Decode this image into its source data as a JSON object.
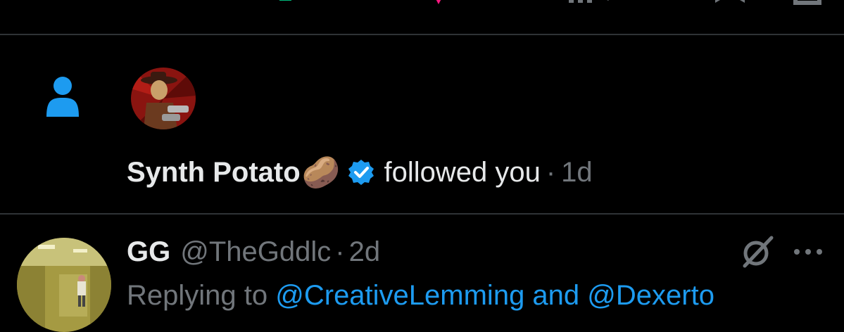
{
  "top_actions": [
    {
      "name": "reply-icon"
    },
    {
      "name": "retweet-icon",
      "color": "#00ba7c"
    },
    {
      "name": "like-icon",
      "color": "#f91880"
    },
    {
      "name": "views-icon"
    },
    {
      "name": "bookmark-icon"
    },
    {
      "name": "share-icon"
    }
  ],
  "notification": {
    "icon": "person-icon",
    "icon_color": "#1d9bf0",
    "user_name": "Synth Potato",
    "emoji": "🥔",
    "verified_icon": "verified-badge-icon",
    "action_text": "followed you",
    "separator": "·",
    "time": "1d"
  },
  "tweet": {
    "name": "GG",
    "handle": "@TheGddlc",
    "separator": "·",
    "time": "2d",
    "replying_prefix": "Replying to",
    "replying_handles": "@CreativeLemming and @Dexerto",
    "icons": [
      "grok-icon",
      "more-icon"
    ]
  },
  "colors": {
    "background": "#000000",
    "text_primary": "#e7e9ea",
    "text_secondary": "#71767b",
    "accent": "#1d9bf0",
    "divider": "#2f3336"
  }
}
